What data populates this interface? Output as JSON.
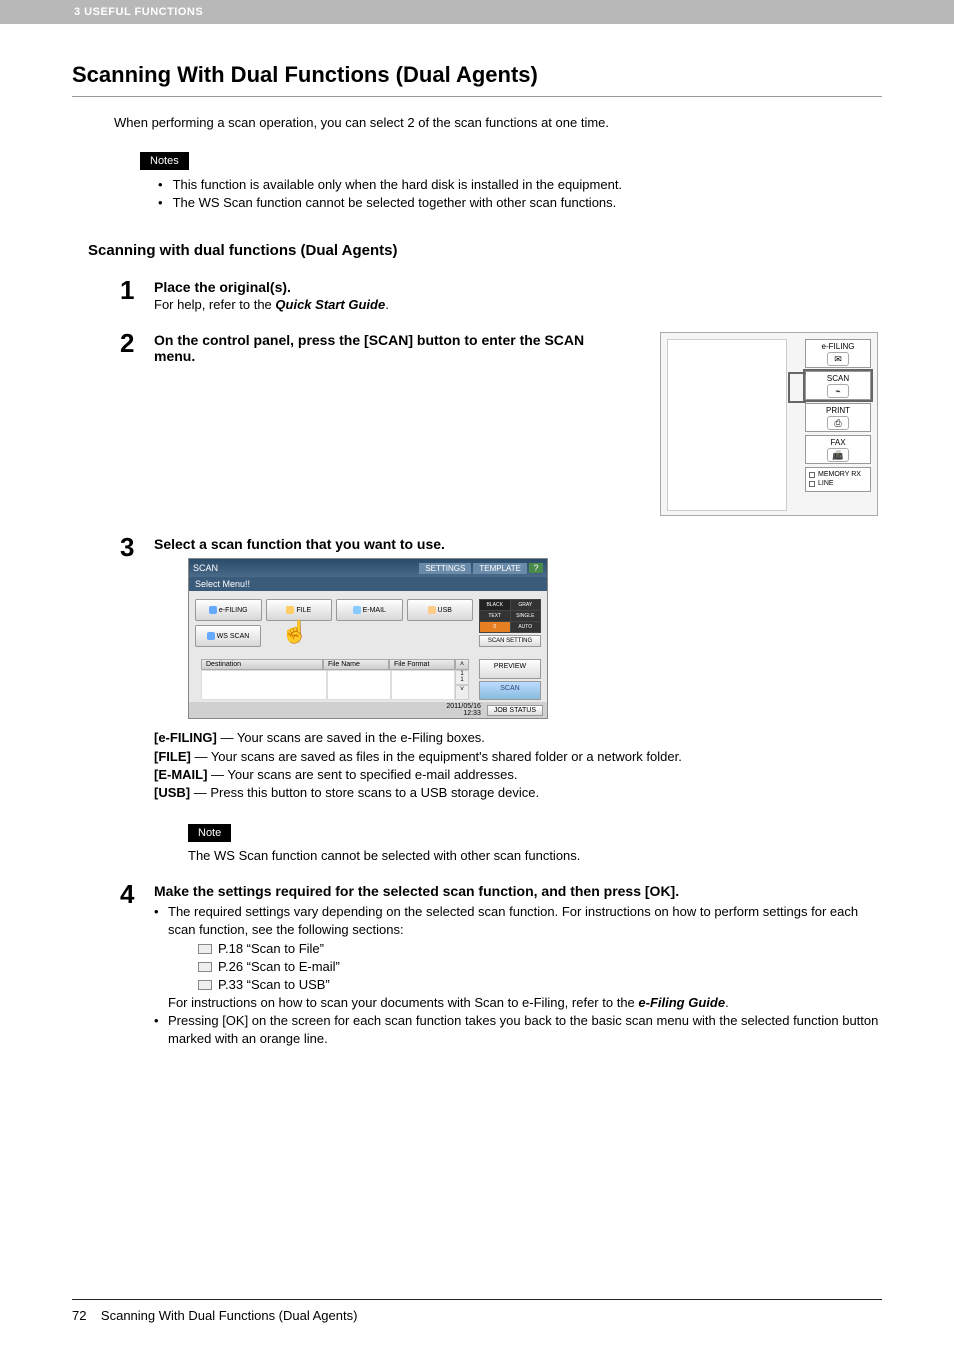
{
  "header_label": "3 USEFUL FUNCTIONS",
  "main_title": "Scanning With Dual Functions (Dual Agents)",
  "intro": "When performing a scan operation, you can select 2 of the scan functions at one time.",
  "notes_label": "Notes",
  "notes": [
    "This function is available only when the hard disk is installed in the equipment.",
    "The WS Scan function cannot be selected together with other scan functions."
  ],
  "sub_heading": "Scanning with dual functions (Dual Agents)",
  "steps": {
    "s1": {
      "num": "1",
      "title": "Place the original(s).",
      "desc_prefix": "For help, refer to the ",
      "desc_ital": "Quick Start Guide",
      "desc_suffix": "."
    },
    "s2": {
      "num": "2",
      "title": "On the control panel, press the [SCAN] button to enter the SCAN menu."
    },
    "s3": {
      "num": "3",
      "title": "Select a scan function that you want to use."
    },
    "s4": {
      "num": "4",
      "title": "Make the settings required for the selected scan function, and then press [OK].",
      "bullet1": "The required settings vary depending on the selected scan function. For instructions on how to perform settings for each scan function, see the following sections:",
      "refs": [
        "P.18 “Scan to File”",
        "P.26 “Scan to E-mail”",
        "P.33 “Scan to USB”"
      ],
      "sub_text_prefix": "For instructions on how to scan your documents with Scan to e-Filing, refer to the ",
      "sub_text_ital": "e-Filing Guide",
      "sub_text_suffix": ".",
      "bullet2": "Pressing [OK] on the screen for each scan function takes you back to the basic scan menu with the selected function button marked with an orange line."
    }
  },
  "panel": {
    "efiling": "e-FILING",
    "scan": "SCAN",
    "print": "PRINT",
    "fax": "FAX",
    "memory_rx": "MEMORY RX",
    "line": "LINE"
  },
  "scan_ui": {
    "title": "SCAN",
    "settings": "SETTINGS",
    "template": "TEMPLATE",
    "help": "?",
    "subtitle": "Select Menu!!",
    "btns": {
      "efiling": "e-FILING",
      "file": "FILE",
      "email": "E-MAIL",
      "usb": "USB",
      "wsscan": "WS SCAN"
    },
    "modes": {
      "black": "BLACK",
      "gray": "GRAY",
      "text": "TEXT",
      "single": "SINGLE",
      "zero": "0",
      "auto": "AUTO"
    },
    "scan_setting": "SCAN SETTING",
    "th": {
      "dest": "Destination",
      "fname": "File Name",
      "fformat": "File Format"
    },
    "page": "1\n1",
    "preview": "PREVIEW",
    "scan_btn": "SCAN",
    "timestamp": "2011/05/16\n12:33",
    "job_status": "JOB STATUS"
  },
  "func_defs": {
    "efiling_label": "[e-FILING]",
    "efiling_text": " — Your scans are saved in the e-Filing boxes.",
    "file_label": "[FILE]",
    "file_text": " — Your scans are saved as files in the equipment's shared folder or a network folder.",
    "email_label": "[E-MAIL]",
    "email_text": " — Your scans are sent to specified e-mail addresses.",
    "usb_label": "[USB]",
    "usb_text": " — Press this button to store scans to a USB storage device."
  },
  "note_label": "Note",
  "note_text": "The WS Scan function cannot be selected with other scan functions.",
  "footer": {
    "page": "72",
    "title": "Scanning With Dual Functions (Dual Agents)"
  }
}
